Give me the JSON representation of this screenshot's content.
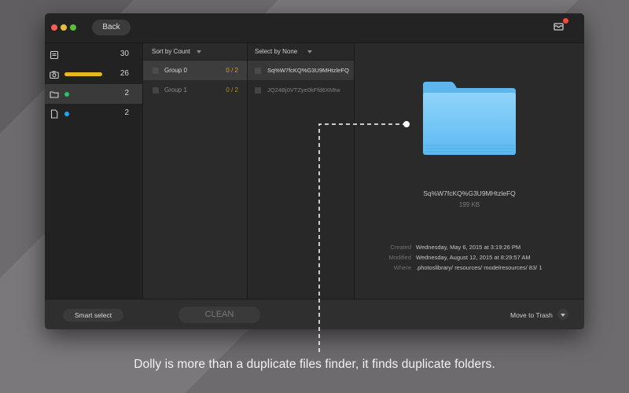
{
  "window": {
    "back_label": "Back",
    "tray_icon": "tray-icon",
    "badge_color": "#f04a3c"
  },
  "sidebar": {
    "items": [
      {
        "icon": "album-icon",
        "count": "30"
      },
      {
        "icon": "camera-icon",
        "count": "26",
        "accent": "#e6b923"
      },
      {
        "icon": "folder-icon",
        "count": "2",
        "accent": "#2bc16b",
        "selected": true
      },
      {
        "icon": "document-icon",
        "count": "2",
        "accent": "#1ea7f2"
      }
    ]
  },
  "groups": {
    "sort_label": "Sort by Count",
    "rows": [
      {
        "name": "Group 0",
        "ratio": "0 / 2",
        "selected": true
      },
      {
        "name": "Group 1",
        "ratio": "0 / 2",
        "selected": false
      }
    ]
  },
  "files": {
    "select_label": "Select by None",
    "rows": [
      {
        "name": "Sq%W7fcKQ%G3U9MHtzleFQ",
        "selected": true
      },
      {
        "name": "JQ24Bj0VTZye0kFfd6XMtw",
        "selected": false
      }
    ]
  },
  "detail": {
    "name": "Sq%W7fcKQ%G3U9MHtzleFQ",
    "size": "199  KB",
    "created_label": "Created",
    "created_value": "Wednesday, May 6, 2015 at 3:19:26 PM",
    "modified_label": "Modified",
    "modified_value": "Wednesday, August 12, 2015 at 8:29:57 AM",
    "where_label": "Where",
    "where_value": ".photoslibrary/ resources/ modelresources/ 83/ 1"
  },
  "bottom": {
    "smart_select_label": "Smart select",
    "clean_label": "CLEAN",
    "trash_label": "Move to Trash"
  },
  "caption": "Dolly is more than a duplicate files finder, it finds duplicate folders."
}
